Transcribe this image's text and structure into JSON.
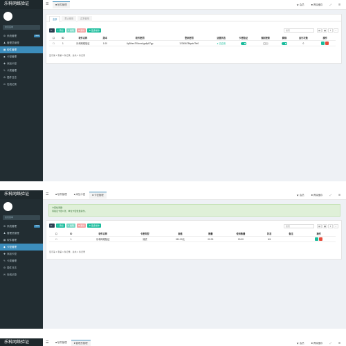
{
  "app": {
    "brand": "乐科网络验证",
    "search_placeholder": "搜索菜单"
  },
  "colors": {
    "sidebar_bg": "#222d32",
    "active": "#3c8dbc",
    "success": "#18bc9c",
    "danger": "#e74c3c"
  },
  "topbar": {
    "right": [
      "★ 会员",
      "■ 清除缓存",
      "⤢",
      "☰"
    ],
    "shot1_tabs": [
      "■ 软件管理"
    ],
    "shot2_tabs": [
      "■ 软件管理",
      "■ 添加卡密",
      "■ 卡密管理"
    ],
    "shot3_tabs": [
      "■ 软件管理",
      "■ 管理员管理"
    ]
  },
  "menu": [
    {
      "icon": "⚙",
      "label": "系统管理",
      "badge": "new"
    },
    {
      "icon": "♟",
      "label": "管理员管理",
      "badge": ""
    },
    {
      "icon": "▦",
      "label": "软件管理",
      "badge": ""
    },
    {
      "icon": "◆",
      "label": "卡密管理",
      "badge": ""
    },
    {
      "icon": "✚",
      "label": "添加卡密",
      "badge": ""
    },
    {
      "icon": "✎",
      "label": "卡类管理",
      "badge": ""
    },
    {
      "icon": "⚙",
      "label": "插件日志",
      "badge": ""
    },
    {
      "icon": "✉",
      "label": "在线记录",
      "badge": ""
    }
  ],
  "shot1": {
    "subtabs": [
      "全部",
      "禁止使用",
      "正常使用"
    ],
    "buttons": {
      "refresh": "↻",
      "add": "+ 添加",
      "edit": "✎ 编辑",
      "delete": "✖ 删除",
      "more": "⚙ 更多操作"
    },
    "search_placeholder": "搜索",
    "columns": [
      "",
      "ID",
      "软件名称",
      "版本",
      "软件密钥",
      "登录密钥",
      "运营状态",
      "卡密验证",
      "强制更新",
      "解绑",
      "运行次数",
      "操作"
    ],
    "rows": [
      {
        "id": "1",
        "name": "乐科网络验证",
        "version": "1.00",
        "key": "6p3hfen7f0lcmx4ga6p87gp",
        "login_key": "12345678fqwb79e0",
        "status": "● 已启用",
        "count": "0"
      }
    ],
    "footer": "显示第 1 到第 1 条记录，总共 1 条记录"
  },
  "shot2": {
    "alert_title": "卡密检测器:",
    "alert_body": "待验证卡密0 张，单位卡密批量操作。",
    "buttons": {
      "refresh": "↻",
      "add": "+ 添加",
      "edit": "✎ 编辑",
      "delete": "✖ 删除",
      "more": "⚙ 更多操作"
    },
    "search_placeholder": "搜索",
    "columns": [
      "",
      "ID",
      "软件名称",
      "卡密类型",
      "面值",
      "数量",
      "使用数量",
      "状态",
      "备注",
      "操作"
    ],
    "rows": [
      {
        "id": "1",
        "name": "乐科网络验证",
        "type": "测试",
        "value": "¥10.00元",
        "count": "00.00",
        "used": "00.00",
        "state": "0/4",
        "note": ""
      }
    ],
    "footer": "显示第 1 到第 1 条记录，总共 1 条记录"
  }
}
